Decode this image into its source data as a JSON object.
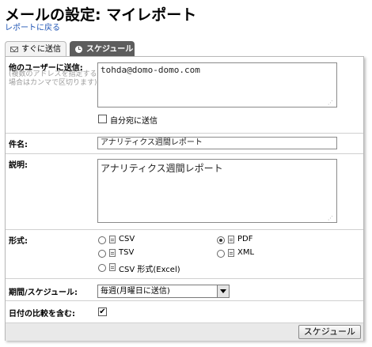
{
  "page": {
    "title": "メールの設定: マイレポート",
    "back_link": "レポートに戻る"
  },
  "tabs": [
    {
      "label": "すぐに送信",
      "icon": "envelope-icon",
      "active": false
    },
    {
      "label": "スケジュール",
      "icon": "clock-icon",
      "active": true
    }
  ],
  "form": {
    "recipients": {
      "label": "他のユーザーに送信:",
      "hint": "(複数のアドレスを指定する場合はカンマで区切ります)",
      "value": "tohda@domo-domo.com",
      "send_to_self_label": "自分宛に送信",
      "send_to_self_checked": false
    },
    "subject": {
      "label": "件名:",
      "value": "アナリティクス週間レポート"
    },
    "description": {
      "label": "説明:",
      "value": "アナリティクス週間レポート"
    },
    "format": {
      "label": "形式:",
      "options": [
        {
          "label": "CSV",
          "selected": false
        },
        {
          "label": "TSV",
          "selected": false
        },
        {
          "label": "CSV 形式(Excel)",
          "selected": false
        },
        {
          "label": "PDF",
          "selected": true
        },
        {
          "label": "XML",
          "selected": false
        }
      ]
    },
    "schedule": {
      "label": "期間/スケジュール:",
      "selected": "毎週(月曜日に送信)"
    },
    "include_comparison": {
      "label": "日付の比較を含む:",
      "checked": true,
      "check_mark": "✔"
    }
  },
  "actions": {
    "submit_label": "スケジュール"
  }
}
